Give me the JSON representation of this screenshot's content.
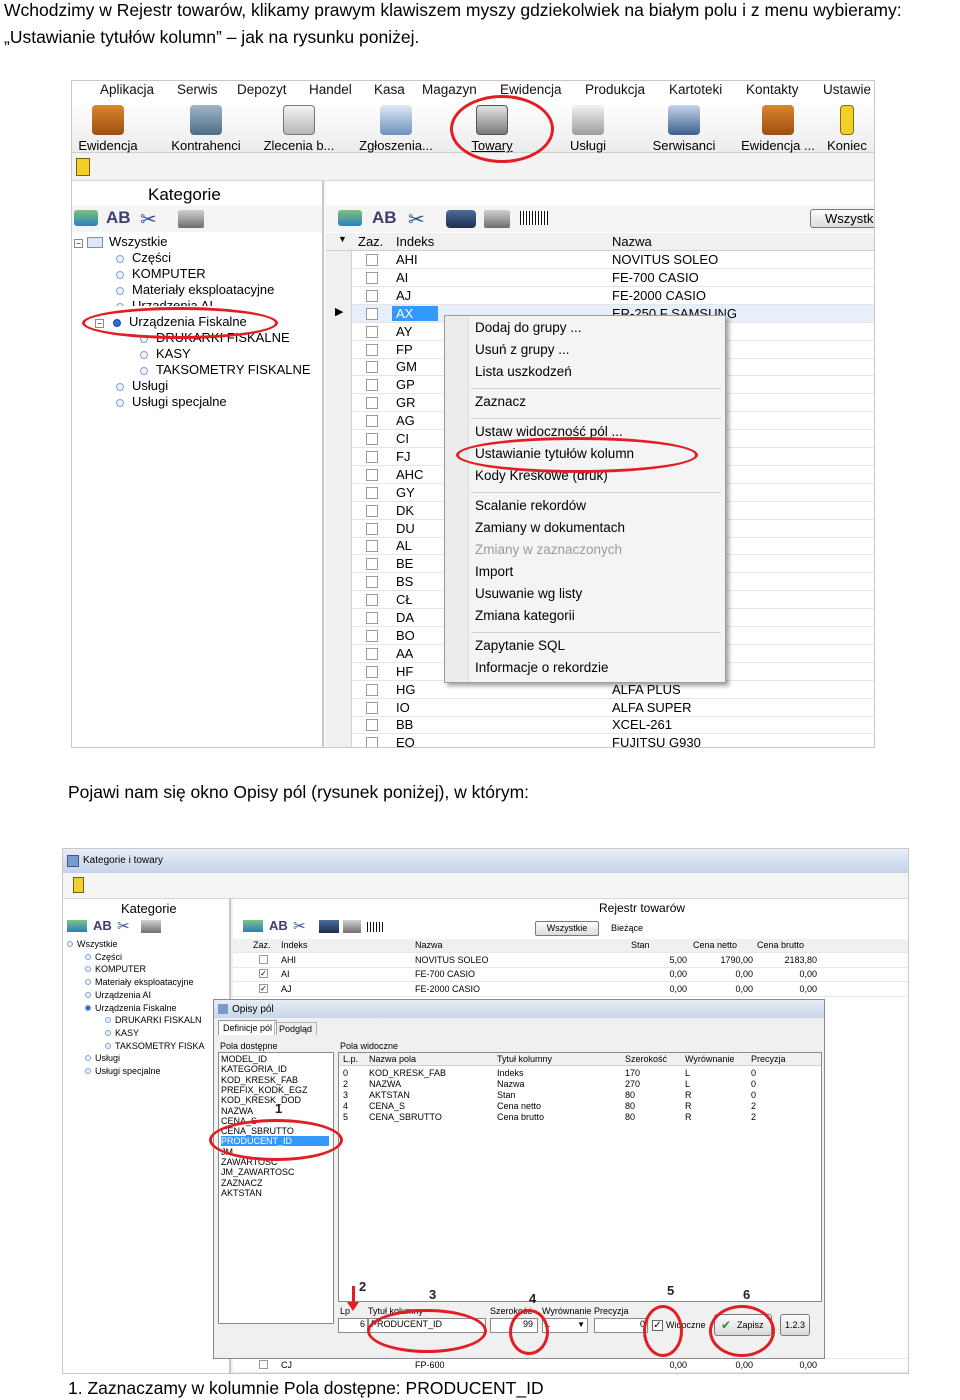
{
  "doc": {
    "intro_line1": "Wchodzimy w Rejestr towarów, klikamy prawym klawiszem myszy gdziekolwiek na białym polu i z menu wybieramy:",
    "intro_line2": "„Ustawianie tytułów kolumn” – jak na rysunku poniżej.",
    "middle_text": "Pojawi nam się okno Opisy pól (rysunek poniżej), w którym:",
    "bottom_item": "1.   Zaznaczamy w kolumnie Pola dostępne: PRODUCENT_ID"
  },
  "shot1": {
    "menu": [
      "Aplikacja",
      "Serwis",
      "Depozyt",
      "Handel",
      "Kasa",
      "Magazyn",
      "Ewidencja",
      "Produkcja",
      "Kartoteki",
      "Kontakty",
      "Ustawie"
    ],
    "toolbar": [
      {
        "label": "Ewidencja",
        "icon": "briefcase-icon"
      },
      {
        "label": "Kontrahenci",
        "icon": "cash-register-icon"
      },
      {
        "label": "Zlecenia b...",
        "icon": "tag-icon"
      },
      {
        "label": "Zgłoszenia...",
        "icon": "document-paragraph-icon"
      },
      {
        "label": "Towary",
        "icon": "cabinet-icon"
      },
      {
        "label": "Usługi",
        "icon": "wrench-icon"
      },
      {
        "label": "Serwisanci",
        "icon": "people-icon"
      },
      {
        "label": "Ewidencja ...",
        "icon": "briefcase-icon"
      },
      {
        "label": "Koniec",
        "icon": "exit-icon"
      }
    ],
    "left_title": "Kategorie",
    "tree": [
      {
        "label": "Wszystkie",
        "level": 0
      },
      {
        "label": "Części",
        "level": 1
      },
      {
        "label": "KOMPUTER",
        "level": 1
      },
      {
        "label": "Materiały eksploatacyjne",
        "level": 1
      },
      {
        "label": "Urządzenia AI",
        "level": 1
      },
      {
        "label": "Urządzenia Fiskalne",
        "level": 1
      },
      {
        "label": "DRUKARKI FISKALNE",
        "level": 2
      },
      {
        "label": "KASY",
        "level": 2
      },
      {
        "label": "TAKSOMETRY FISKALNE",
        "level": 2
      },
      {
        "label": "Usługi",
        "level": 1
      },
      {
        "label": "Usługi specjalne",
        "level": 1
      }
    ],
    "filter_btn": "Wszystk",
    "col_zaz": "Zaz.",
    "col_indeks": "Indeks",
    "col_nazwa": "Nazwa",
    "rows": [
      {
        "indeks": "AHI",
        "nazwa": "NOVITUS SOLEO"
      },
      {
        "indeks": "AI",
        "nazwa": "FE-700 CASIO"
      },
      {
        "indeks": "AJ",
        "nazwa": "FE-2000 CASIO"
      },
      {
        "indeks": "AX",
        "nazwa": "ER-250 F SAMSUNG"
      },
      {
        "indeks": "AY",
        "nazwa": "NG"
      },
      {
        "indeks": "FP",
        "nazwa": "NG"
      },
      {
        "indeks": "GM",
        "nazwa": "NG"
      },
      {
        "indeks": "GP",
        "nazwa": ""
      },
      {
        "indeks": "GR",
        "nazwa": ""
      },
      {
        "indeks": "AG",
        "nazwa": ""
      },
      {
        "indeks": "CI",
        "nazwa": ""
      },
      {
        "indeks": "FJ",
        "nazwa": ""
      },
      {
        "indeks": "AHC",
        "nazwa": ""
      },
      {
        "indeks": "GY",
        "nazwa": ""
      },
      {
        "indeks": "DK",
        "nazwa": ""
      },
      {
        "indeks": "DU",
        "nazwa": "A"
      },
      {
        "indeks": "AL",
        "nazwa": "24"
      },
      {
        "indeks": "BE",
        "nazwa": "20"
      },
      {
        "indeks": "BS",
        "nazwa": "52"
      },
      {
        "indeks": "CŁ",
        "nazwa": "01"
      },
      {
        "indeks": "DA",
        "nazwa": "53"
      },
      {
        "indeks": "BO",
        "nazwa": ""
      },
      {
        "indeks": "AA",
        "nazwa": ""
      },
      {
        "indeks": "HF",
        "nazwa": ""
      },
      {
        "indeks": "HG",
        "nazwa": "ALFA PLUS"
      },
      {
        "indeks": "IO",
        "nazwa": "ALFA SUPER"
      },
      {
        "indeks": "BB",
        "nazwa": "XCEL-261"
      },
      {
        "indeks": "EO",
        "nazwa": "FUJITSU G930"
      }
    ],
    "context_menu": [
      {
        "label": "Dodaj do grupy ...",
        "disabled": false
      },
      {
        "label": "Usuń z grupy ...",
        "disabled": false
      },
      {
        "label": "Lista uszkodzeń",
        "disabled": false
      },
      {
        "label": "Zaznacz",
        "disabled": false
      },
      {
        "label": "Ustaw widoczność pól ...",
        "disabled": false
      },
      {
        "label": "Ustawianie tytułów kolumn",
        "disabled": false
      },
      {
        "label": "Kody Kreskowe (druk)",
        "disabled": false
      },
      {
        "label": "Scalanie rekordów",
        "disabled": false
      },
      {
        "label": "Zamiany w dokumentach",
        "disabled": false
      },
      {
        "label": "Zmiany w zaznaczonych",
        "disabled": true
      },
      {
        "label": "Import",
        "disabled": false
      },
      {
        "label": "Usuwanie wg listy",
        "disabled": false
      },
      {
        "label": "Zmiana kategorii",
        "disabled": false
      },
      {
        "label": "Zapytanie SQL",
        "disabled": false
      },
      {
        "label": "Informacje o rekordzie",
        "disabled": false
      }
    ]
  },
  "shot2": {
    "window_title": "Kategorie i towary",
    "left_title": "Kategorie",
    "right_title": "Rejestr towarów",
    "tab_all": "Wszystkie",
    "tab_current": "Bieżące",
    "tree": [
      {
        "label": "Wszystkie",
        "level": 0
      },
      {
        "label": "Części",
        "level": 1
      },
      {
        "label": "KOMPUTER",
        "level": 1
      },
      {
        "label": "Materiały eksploatacyjne",
        "level": 1
      },
      {
        "label": "Urządzenia AI",
        "level": 1
      },
      {
        "label": "Urządzenia Fiskalne",
        "level": 1
      },
      {
        "label": "DRUKARKI FISKALN",
        "level": 2
      },
      {
        "label": "KASY",
        "level": 2
      },
      {
        "label": "TAKSOMETRY FISKA",
        "level": 2
      },
      {
        "label": "Usługi",
        "level": 1
      },
      {
        "label": "Usługi specjalne",
        "level": 1
      }
    ],
    "grid_headers": [
      "Zaz.",
      "Indeks",
      "Nazwa",
      "Stan",
      "Cena netto",
      "Cena brutto"
    ],
    "grid_rows": [
      [
        "",
        "AHI",
        "NOVITUS SOLEO",
        "5,00",
        "1790,00",
        "2183,80"
      ],
      [
        "✓",
        "AI",
        "FE-700 CASIO",
        "0,00",
        "0,00",
        "0,00"
      ],
      [
        "✓",
        "AJ",
        "FE-2000 CASIO",
        "0,00",
        "0,00",
        "0,00"
      ]
    ],
    "grid_bottom_rows": [
      [
        "",
        "EP",
        "SYSTEM 500",
        "0,00",
        "0,00",
        "0,00"
      ],
      [
        "",
        "CJ",
        "FP-600",
        "0,00",
        "0,00",
        "0,00"
      ]
    ],
    "dialog": {
      "title": "Opisy pól",
      "tab1": "Definicje pól",
      "tab2": "Podgląd",
      "available_label": "Pola dostępne",
      "available": [
        "MODEL_ID",
        "KATEGORIA_ID",
        "KOD_KRESK_FAB",
        "PREFIX_KODK_EGZ",
        "KOD_KRESK_DOD",
        "NAZWA",
        "CENA_S",
        "CENA_SBRUTTO",
        "PRODUCENT_ID",
        "JM",
        "ZAWARTOSC",
        "JM_ZAWARTOSC",
        "ZAZNACZ",
        "AKTSTAN"
      ],
      "selected_available": "PRODUCENT_ID",
      "visible_label": "Pola widoczne",
      "visible_headers": [
        "L.p.",
        "Nazwa pola",
        "Tytuł kolumny",
        "Szerokość",
        "Wyrównanie",
        "Precyzja"
      ],
      "visible_rows": [
        [
          "0",
          "KOD_KRESK_FAB",
          "Indeks",
          "170",
          "L",
          "0"
        ],
        [
          "2",
          "NAZWA",
          "Nazwa",
          "270",
          "L",
          "0"
        ],
        [
          "3",
          "AKTSTAN",
          "Stan",
          "80",
          "R",
          "0"
        ],
        [
          "4",
          "CENA_S",
          "Cena netto",
          "80",
          "R",
          "2"
        ],
        [
          "5",
          "CENA_SBRUTTO",
          "Cena brutto",
          "80",
          "R",
          "2"
        ]
      ],
      "edit_labels": {
        "lp": "Lp",
        "title": "Tytuł kolumny",
        "width": "Szerokość",
        "align": "Wyrównanie",
        "precision": "Precyzja"
      },
      "edit_values": {
        "lp": "6",
        "title": "PRODUCENT_ID",
        "width": "99",
        "align": "L",
        "precision": "0"
      },
      "visible_check": "Widoczne",
      "save_btn": "Zapisz",
      "btn_123": "1.2.3",
      "markers": [
        "1",
        "2",
        "3",
        "4",
        "5",
        "6"
      ]
    }
  },
  "colors": {
    "highlight_red": "#e01e24",
    "selection_blue": "#3399ff"
  }
}
